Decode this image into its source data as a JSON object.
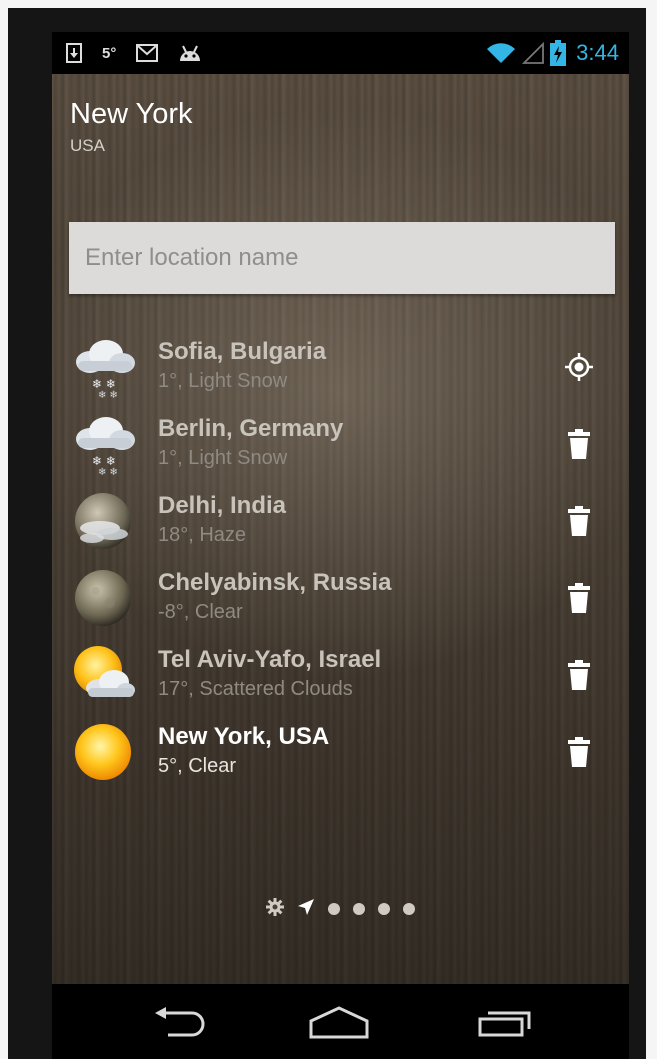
{
  "status_bar": {
    "temp_icon_text": "5°",
    "time": "3:44",
    "left_icons": [
      "download-icon",
      "mail-icon",
      "android-icon"
    ],
    "right_icons": [
      "wifi-icon",
      "signal-icon",
      "battery-charging-icon"
    ],
    "accent_color": "#33b5e5"
  },
  "header": {
    "city": "New York",
    "country": "USA"
  },
  "search": {
    "placeholder": "Enter location name"
  },
  "locations": [
    {
      "name": "Sofia, Bulgaria",
      "condition": "1°, Light Snow",
      "icon": "snow-cloud-icon",
      "action": "current-location-icon"
    },
    {
      "name": "Berlin, Germany",
      "condition": "1°, Light Snow",
      "icon": "snow-cloud-icon",
      "action": "trash-icon"
    },
    {
      "name": "Delhi, India",
      "condition": "18°, Haze",
      "icon": "moon-haze-icon",
      "action": "trash-icon"
    },
    {
      "name": "Chelyabinsk, Russia",
      "condition": "-8°, Clear",
      "icon": "moon-icon",
      "action": "trash-icon"
    },
    {
      "name": "Tel Aviv-Yafo, Israel",
      "condition": "17°, Scattered Clouds",
      "icon": "sun-cloud-icon",
      "action": "trash-icon"
    },
    {
      "name": "New York, USA",
      "condition": "5°, Clear",
      "icon": "sun-icon",
      "action": "trash-icon",
      "selected": true
    }
  ],
  "pager": {
    "items": [
      "settings-icon",
      "location-arrow-icon",
      "page-dot",
      "page-dot",
      "page-dot",
      "page-dot"
    ]
  },
  "nav_bar": {
    "buttons": [
      "back-icon",
      "home-icon",
      "recent-apps-icon"
    ]
  }
}
